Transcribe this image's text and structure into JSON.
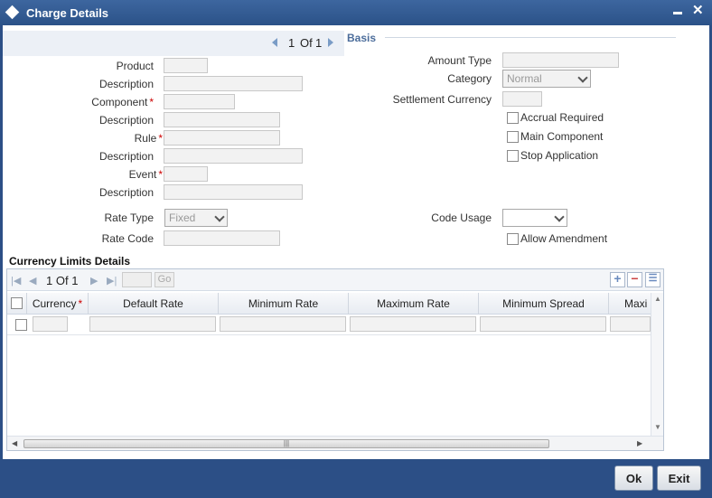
{
  "window": {
    "title": "Charge Details",
    "minimize_glyph": "▬",
    "close_glyph": "✕"
  },
  "record_pager": {
    "current": "1",
    "of_label": "Of",
    "total": "1"
  },
  "basis_legend": "Basis",
  "left_fields": {
    "product_label": "Product",
    "product_description_label": "Description",
    "component_label": "Component",
    "component_description_label": "Description",
    "rule_label": "Rule",
    "rule_description_label": "Description",
    "event_label": "Event",
    "event_description_label": "Description",
    "required_mark": "*",
    "rate_type_label": "Rate Type",
    "rate_type_value": "Fixed",
    "rate_code_label": "Rate Code"
  },
  "right_fields": {
    "amount_type_label": "Amount Type",
    "category_label": "Category",
    "category_value": "Normal",
    "settlement_currency_label": "Settlement Currency",
    "accrual_required_label": "Accrual Required",
    "main_component_label": "Main Component",
    "stop_application_label": "Stop Application",
    "code_usage_label": "Code Usage",
    "code_usage_value": "",
    "allow_amendment_label": "Allow Amendment"
  },
  "currency_limits": {
    "section_title": "Currency Limits Details",
    "pager": {
      "current": "1",
      "of_label": "Of",
      "total": "1"
    },
    "go_label": "Go",
    "columns": [
      "Currency",
      "Default Rate",
      "Minimum Rate",
      "Maximum Rate",
      "Minimum Spread",
      "Maxi"
    ],
    "required_mark": "*",
    "add_glyph": "+",
    "delete_glyph": "−",
    "single_view_glyph": "☰"
  },
  "footer": {
    "ok_label": "Ok",
    "exit_label": "Exit"
  },
  "colors": {
    "titlebar": "#2c4f86",
    "accent_blue": "#4c6d9b",
    "required_red": "#cc0000"
  }
}
